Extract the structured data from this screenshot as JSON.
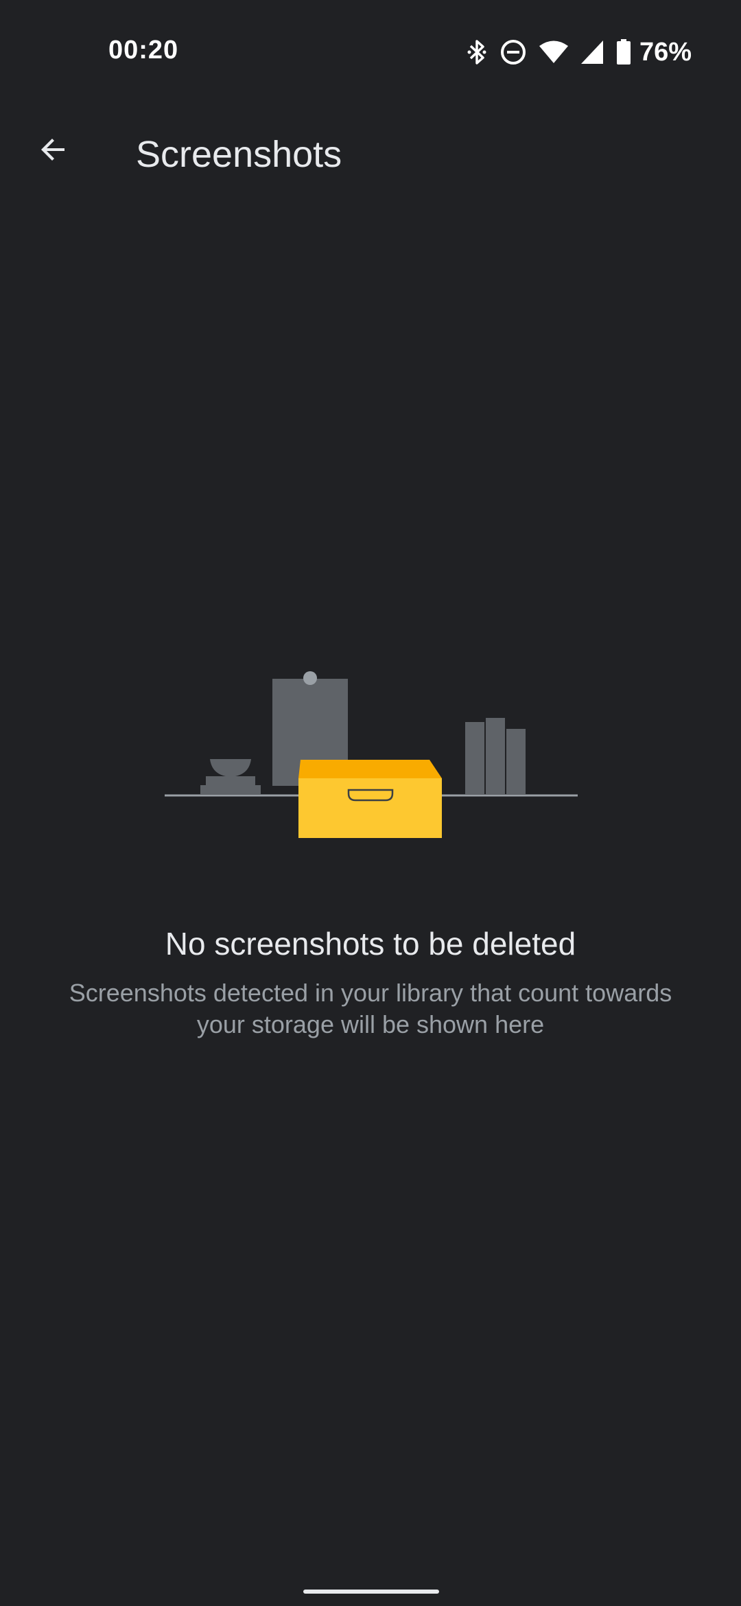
{
  "status_bar": {
    "time": "00:20",
    "battery_percent": "76%",
    "icons": [
      "bluetooth-icon",
      "do-not-disturb-icon",
      "wifi-icon",
      "cell-signal-icon",
      "battery-icon"
    ]
  },
  "app_bar": {
    "title": "Screenshots",
    "back_icon": "arrow-back-icon"
  },
  "empty_state": {
    "illustration": "empty-shelf-with-box-illustration",
    "title": "No screenshots to be deleted",
    "subtitle": "Screenshots detected in your library that count towards your storage will be shown here"
  },
  "colors": {
    "background": "#202124",
    "box_front": "#fdc830",
    "box_lid": "#f9ab00",
    "shelf_items": "#5f6368",
    "text_primary": "#e8eaed",
    "text_secondary": "#9aa0a6"
  }
}
